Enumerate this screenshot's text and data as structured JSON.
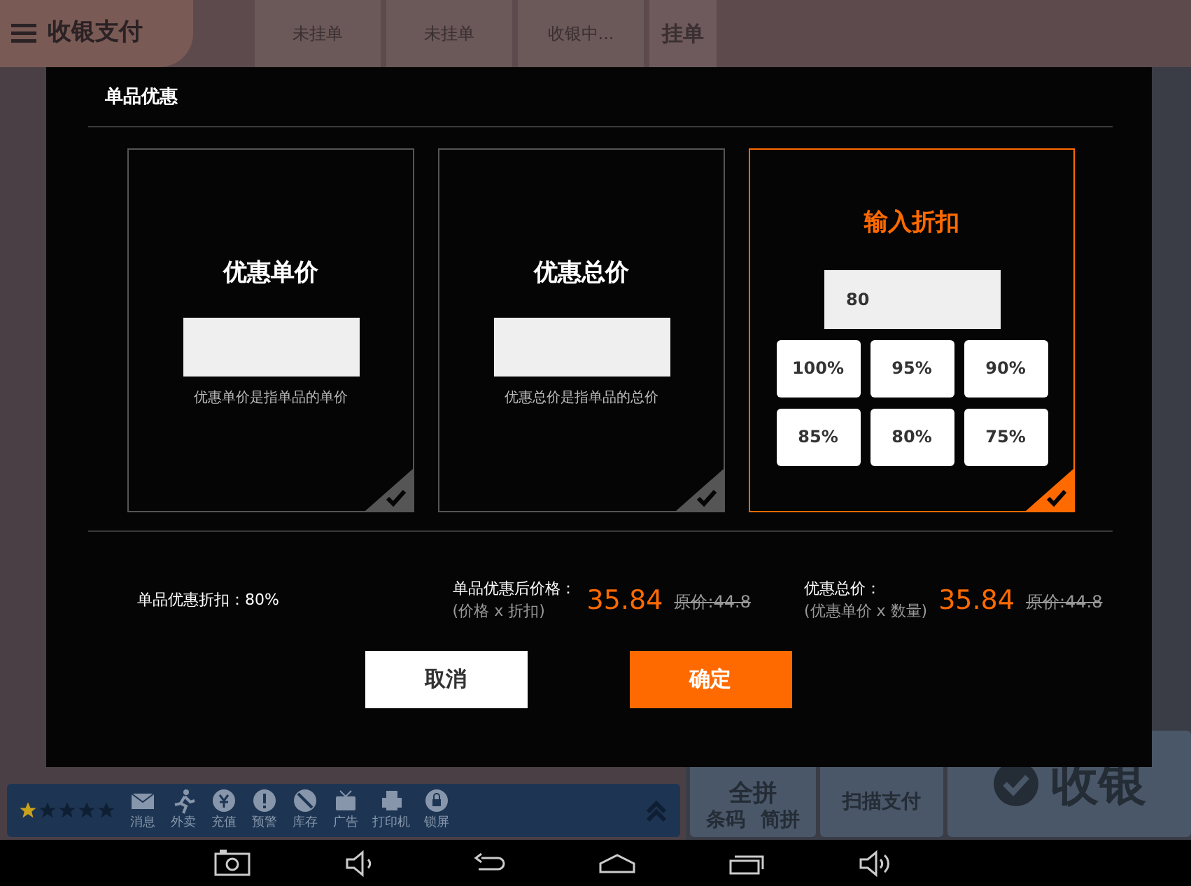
{
  "header": {
    "title": "收银支付"
  },
  "order_tabs": [
    {
      "label": "未挂单"
    },
    {
      "label": "未挂单"
    },
    {
      "label": "收银中..."
    }
  ],
  "hold_button": "挂单",
  "dialog": {
    "title": "单品优惠",
    "options": [
      {
        "kind": "price",
        "title": "优惠单价",
        "hint": "优惠单价是指单品的单价",
        "selected": false
      },
      {
        "kind": "price",
        "title": "优惠总价",
        "hint": "优惠总价是指单品的总价",
        "selected": false
      },
      {
        "kind": "discount",
        "title": "输入折扣",
        "value": "80",
        "presets": [
          "100%",
          "95%",
          "90%",
          "85%",
          "80%",
          "75%"
        ],
        "selected": true
      }
    ],
    "discount_summary": "单品优惠折扣：80%",
    "unit_price": {
      "label": "单品优惠后价格：",
      "formula": "(价格 x 折扣)",
      "price": "35.84",
      "original": "原价:44.8"
    },
    "total_price": {
      "label": "优惠总价：",
      "formula": "(优惠单价 x 数量)",
      "price": "35.84",
      "original": "原价:44.8"
    },
    "buttons": [
      {
        "kind": "secondary",
        "label": "取消"
      },
      {
        "kind": "primary",
        "label": "确定"
      }
    ]
  },
  "toolbar": {
    "stars": 1,
    "items": [
      {
        "kind": "mail",
        "label": "消息"
      },
      {
        "kind": "runner",
        "label": "外卖"
      },
      {
        "kind": "yen",
        "label": "充值"
      },
      {
        "kind": "alert",
        "label": "预警"
      },
      {
        "kind": "stock",
        "label": "库存"
      },
      {
        "kind": "ad",
        "label": "广告"
      },
      {
        "kind": "printer",
        "label": "打印机"
      },
      {
        "kind": "lock",
        "label": "锁屏"
      }
    ]
  },
  "input_modes": [
    "全拼",
    "条码",
    "简拼"
  ],
  "scan_pay": "扫描支付",
  "checkout": "收银"
}
